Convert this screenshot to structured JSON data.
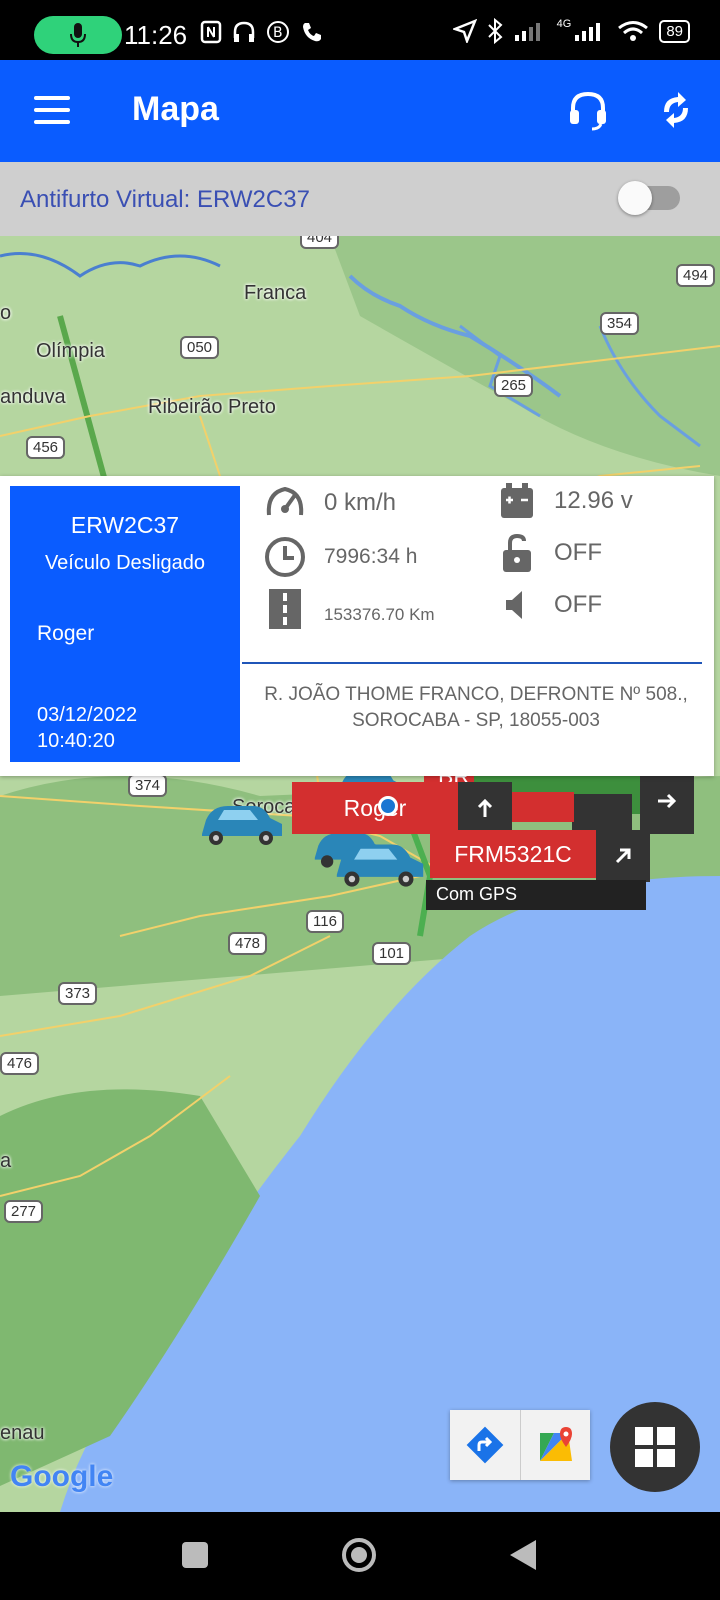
{
  "status_bar": {
    "time": "11:26",
    "network": "4G",
    "battery": "89"
  },
  "app_bar": {
    "title": "Mapa"
  },
  "antifurto": {
    "label": "Antifurto Virtual: ERW2C37",
    "enabled": false
  },
  "map": {
    "places": [
      "Franca",
      "Olímpia",
      "anduva",
      "Ribeirão Preto",
      "Sorocab",
      "o"
    ],
    "road_shields": [
      "494",
      "354",
      "050",
      "265",
      "456",
      "374",
      "116",
      "478",
      "101",
      "373",
      "476",
      "277",
      "404"
    ],
    "partial_places": [
      "a",
      "enau"
    ],
    "attribution": "Google"
  },
  "info_card": {
    "plate": "ERW2C37",
    "vehicle_status": "Veículo Desligado",
    "driver": "Roger",
    "date": "03/12/2022",
    "time": "10:40:20",
    "speed": "0 km/h",
    "voltage": "12.96 v",
    "hours": "7996:34 h",
    "lock": "OFF",
    "odometer": "153376.70 Km",
    "sound": "OFF",
    "address": "R. JOÃO THOME FRANCO, DEFRONTE Nº 508., SOROCABA - SP, 18055-003"
  },
  "markers": {
    "roger_label": "Roger",
    "partial_label": "BR",
    "frm_label": "FRM5321C",
    "gps_label": "Com GPS"
  },
  "colors": {
    "primary": "#0a5cff",
    "marker_red": "#d32f2f",
    "marker_green": "#3d8f3d",
    "sea": "#8ab4f8",
    "land": "#a6cc94"
  }
}
